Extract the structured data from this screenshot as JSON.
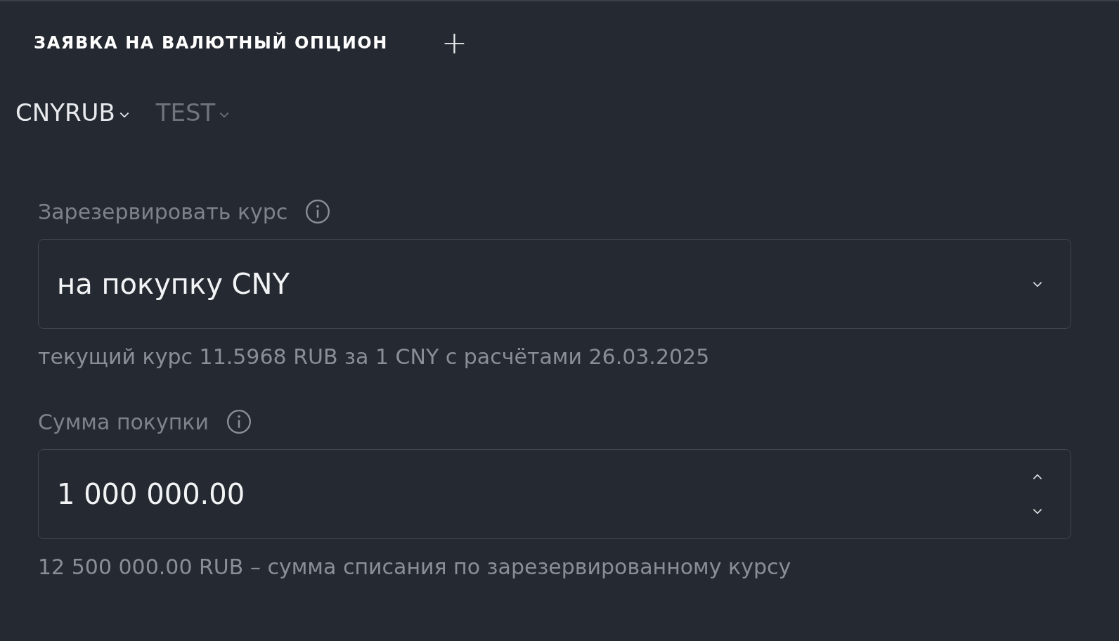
{
  "header": {
    "title": "ЗАЯВКА НА ВАЛЮТНЫЙ ОПЦИОН",
    "add_icon": "+"
  },
  "tabs": [
    {
      "label": "CNYRUB",
      "selected": true
    },
    {
      "label": "TEST",
      "selected": false
    }
  ],
  "fields": [
    {
      "kind": "select",
      "label": "Зарезервировать курс",
      "value": "на покупку CNY",
      "hint": "текущий курс 11.5968 RUB за 1 CNY с расчётами 26.03.2025"
    },
    {
      "kind": "number",
      "label": "Сумма покупки",
      "value": "1 000 000.00",
      "hint": "12 500 000.00 RUB – сумма списания по зарезервированному курсу"
    }
  ]
}
